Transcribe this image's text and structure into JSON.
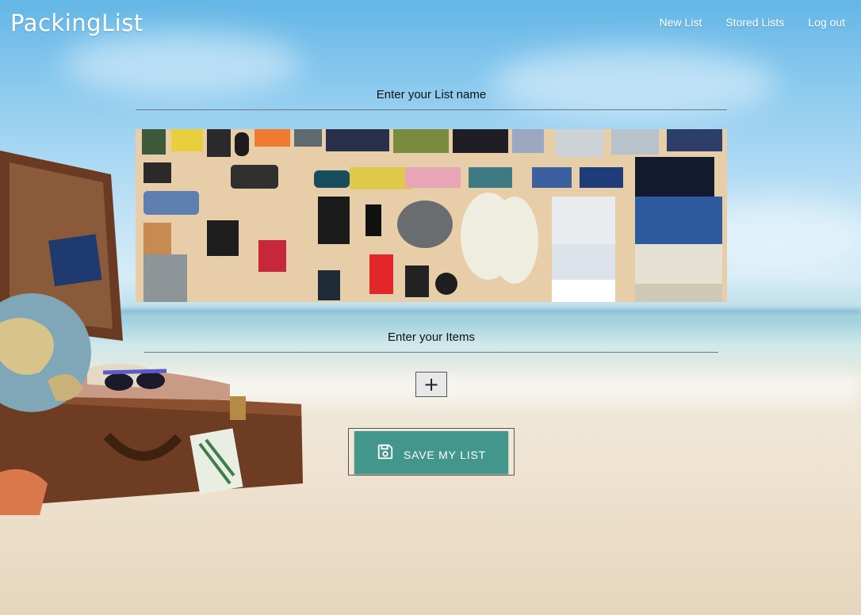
{
  "app": {
    "brand": "PackingList"
  },
  "nav": [
    {
      "label": "New List"
    },
    {
      "label": "Stored Lists"
    },
    {
      "label": "Log out"
    }
  ],
  "form": {
    "list_name_placeholder": "Enter your List name",
    "list_name_value": "",
    "items_placeholder": "Enter your Items",
    "items_value": "",
    "add_icon": "plus-icon",
    "save_label": "SAVE MY LIST",
    "save_icon": "floppy-disk-icon"
  },
  "colors": {
    "save_button": "#43968c",
    "nav_text": "#ffffff"
  }
}
